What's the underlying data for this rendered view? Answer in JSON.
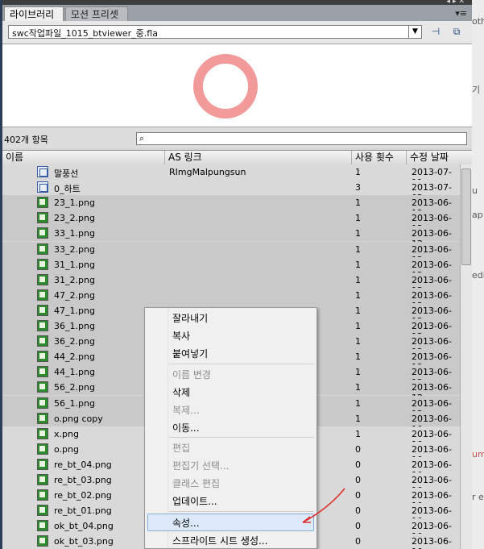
{
  "tabs": [
    {
      "label": "라이브러리",
      "active": true
    },
    {
      "label": "모션 프리셋",
      "active": false
    }
  ],
  "document": {
    "selected": "swc작업파일_1015_btviewer_중.fla"
  },
  "item_count": "402개 항목",
  "search": {
    "value": "",
    "placeholder": ""
  },
  "columns": {
    "name": "이름",
    "linkage": "AS 링크",
    "use_count": "사용 횟수",
    "date": "수정 날짜"
  },
  "rows": [
    {
      "name": "말풍선",
      "linkage": "RImgMalpungsun",
      "use_count": "1",
      "date": "2013-07-11",
      "type": "symbol",
      "selected": false
    },
    {
      "name": "0_하트",
      "linkage": "",
      "use_count": "3",
      "date": "2013-07-02",
      "type": "symbol",
      "selected": false
    },
    {
      "name": "23_1.png",
      "linkage": "",
      "use_count": "1",
      "date": "2013-06-12",
      "type": "bitmap",
      "selected": true
    },
    {
      "name": "23_2.png",
      "linkage": "",
      "use_count": "1",
      "date": "2013-06-12",
      "type": "bitmap",
      "selected": true
    },
    {
      "name": "33_1.png",
      "linkage": "",
      "use_count": "1",
      "date": "2013-06-12",
      "type": "bitmap",
      "selected": true
    },
    {
      "name": "33_2.png",
      "linkage": "",
      "use_count": "1",
      "date": "2013-06-12",
      "type": "bitmap",
      "selected": true
    },
    {
      "name": "31_1.png",
      "linkage": "",
      "use_count": "1",
      "date": "2013-06-12",
      "type": "bitmap",
      "selected": true
    },
    {
      "name": "31_2.png",
      "linkage": "",
      "use_count": "1",
      "date": "2013-06-12",
      "type": "bitmap",
      "selected": true
    },
    {
      "name": "47_2.png",
      "linkage": "",
      "use_count": "1",
      "date": "2013-06-12",
      "type": "bitmap",
      "selected": true
    },
    {
      "name": "47_1.png",
      "linkage": "",
      "use_count": "1",
      "date": "2013-06-12",
      "type": "bitmap",
      "selected": true
    },
    {
      "name": "36_1.png",
      "linkage": "",
      "use_count": "1",
      "date": "2013-06-12",
      "type": "bitmap",
      "selected": true
    },
    {
      "name": "36_2.png",
      "linkage": "",
      "use_count": "1",
      "date": "2013-06-12",
      "type": "bitmap",
      "selected": true
    },
    {
      "name": "44_2.png",
      "linkage": "",
      "use_count": "1",
      "date": "2013-06-12",
      "type": "bitmap",
      "selected": true
    },
    {
      "name": "44_1.png",
      "linkage": "",
      "use_count": "1",
      "date": "2013-06-12",
      "type": "bitmap",
      "selected": true
    },
    {
      "name": "56_2.png",
      "linkage": "",
      "use_count": "1",
      "date": "2013-06-12",
      "type": "bitmap",
      "selected": true
    },
    {
      "name": "56_1.png",
      "linkage": "",
      "use_count": "1",
      "date": "2013-06-12",
      "type": "bitmap",
      "selected": true
    },
    {
      "name": "o.png copy",
      "linkage": "",
      "use_count": "1",
      "date": "2013-06-10",
      "type": "bitmap",
      "selected": true
    },
    {
      "name": "x.png",
      "linkage": "",
      "use_count": "1",
      "date": "2013-06-10",
      "type": "bitmap",
      "selected": false
    },
    {
      "name": "o.png",
      "linkage": "",
      "use_count": "0",
      "date": "2013-06-10",
      "type": "bitmap",
      "selected": false
    },
    {
      "name": "re_bt_04.png",
      "linkage": "",
      "use_count": "0",
      "date": "2013-06-10",
      "type": "bitmap",
      "selected": false
    },
    {
      "name": "re_bt_03.png",
      "linkage": "",
      "use_count": "0",
      "date": "2013-06-10",
      "type": "bitmap",
      "selected": false
    },
    {
      "name": "re_bt_02.png",
      "linkage": "",
      "use_count": "0",
      "date": "2013-06-10",
      "type": "bitmap",
      "selected": false
    },
    {
      "name": "re_bt_01.png",
      "linkage": "",
      "use_count": "0",
      "date": "2013-06-10",
      "type": "bitmap",
      "selected": false
    },
    {
      "name": "ok_bt_04.png",
      "linkage": "",
      "use_count": "0",
      "date": "2013-06-10",
      "type": "bitmap",
      "selected": false
    },
    {
      "name": "ok_bt_03.png",
      "linkage": "",
      "use_count": "0",
      "date": "2013-06-10",
      "type": "bitmap",
      "selected": false
    }
  ],
  "context_menu": [
    {
      "label": "잘라내기",
      "disabled": false
    },
    {
      "label": "복사",
      "disabled": false
    },
    {
      "label": "붙여넣기",
      "disabled": false
    },
    {
      "label": "이름 변경",
      "disabled": true
    },
    {
      "label": "삭제",
      "disabled": false
    },
    {
      "label": "복제...",
      "disabled": true
    },
    {
      "label": "이동...",
      "disabled": false
    },
    {
      "label": "편집",
      "disabled": true
    },
    {
      "label": "편집기 선택...",
      "disabled": true
    },
    {
      "label": "클래스 편집",
      "disabled": true
    },
    {
      "label": "업데이트...",
      "disabled": false
    },
    {
      "label": "속성...",
      "disabled": false,
      "highlighted": true
    },
    {
      "label": "스프라이트 시트 생성...",
      "disabled": false
    }
  ],
  "background_fragments": [
    "oth",
    "ap",
    "edi",
    "u",
    "um",
    "r e",
    "기"
  ],
  "colors": {
    "preview_ring": "#f29a9a",
    "selection": "#c9c9c9",
    "menu_highlight": "#dbe9fb",
    "annotation_arrow": "#e03030"
  },
  "icons": {
    "search": "magnifier-icon",
    "doc_dropdown": "chevron-down-icon",
    "pin": "pin-icon",
    "new_library": "new-library-icon",
    "panel_menu": "panel-menu-icon"
  }
}
